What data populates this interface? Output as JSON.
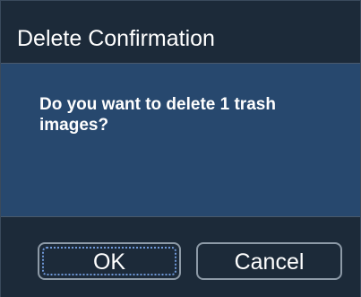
{
  "dialog": {
    "title": "Delete Confirmation",
    "message": "Do you want to delete 1 trash images?",
    "buttons": {
      "ok_label": "OK",
      "cancel_label": "Cancel"
    }
  },
  "colors": {
    "titlebar_bg": "#1c2a39",
    "body_bg": "#27486e",
    "button_border": "#8d9aa7",
    "focus_ring": "#6f98d8",
    "text": "#ffffff"
  }
}
